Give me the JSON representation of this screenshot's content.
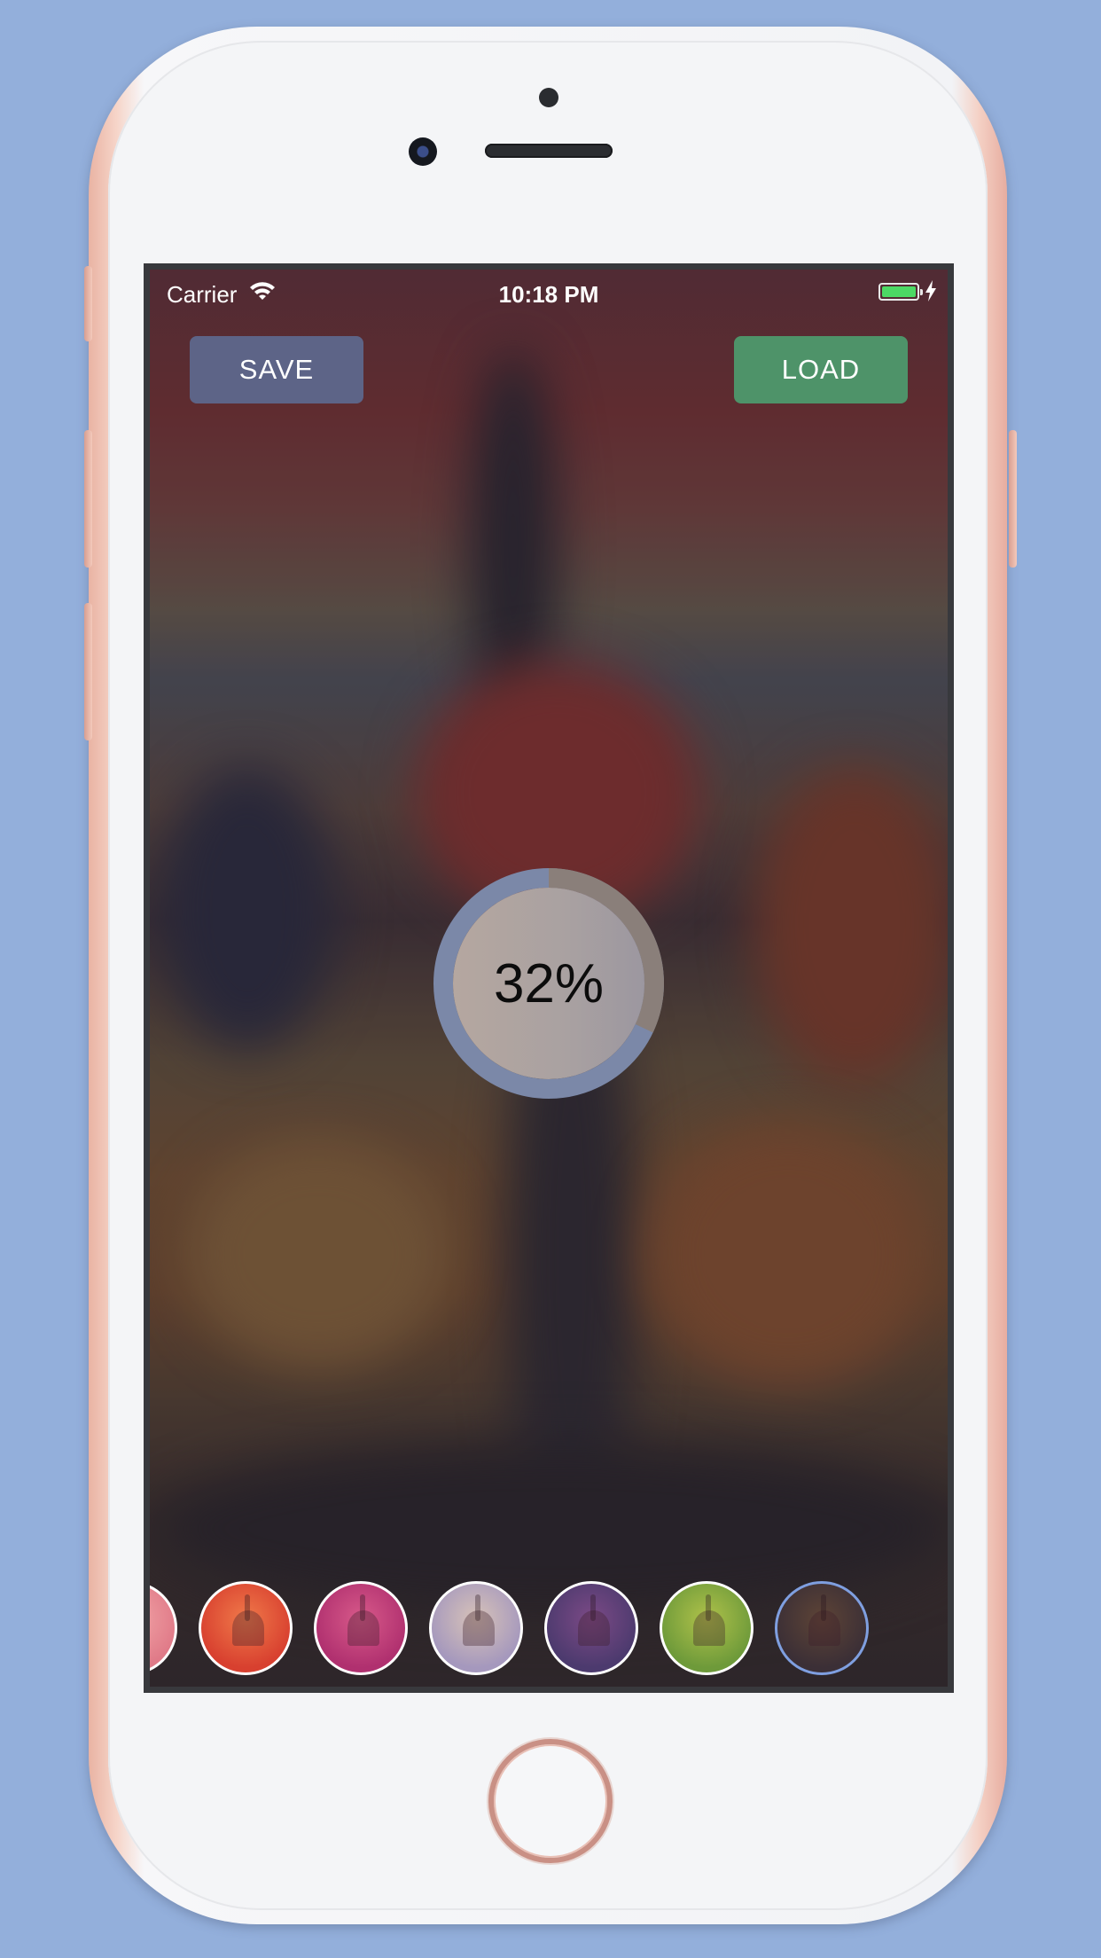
{
  "status_bar": {
    "carrier": "Carrier",
    "time": "10:18 PM",
    "battery_color": "#4cd964"
  },
  "toolbar": {
    "save_label": "SAVE",
    "load_label": "LOAD",
    "save_color": "#5d6487",
    "load_color": "#4e9369"
  },
  "progress": {
    "label": "32%",
    "fraction": 0.32,
    "ring_color": "#7b88a8",
    "fill_color": "#8a7f7a"
  },
  "filters": [
    {
      "name": "filter-pink",
      "base": "#e07a88",
      "accent": "#f2a6a8",
      "selected": false
    },
    {
      "name": "filter-red",
      "base": "#d8402f",
      "accent": "#f07a4a",
      "selected": false
    },
    {
      "name": "filter-magenta",
      "base": "#b0306f",
      "accent": "#d85a8a",
      "selected": false
    },
    {
      "name": "filter-lavender",
      "base": "#a598bd",
      "accent": "#d8c3b8",
      "selected": false
    },
    {
      "name": "filter-purple",
      "base": "#4c3a6e",
      "accent": "#7c4a86",
      "selected": false
    },
    {
      "name": "filter-green",
      "base": "#6e9a3a",
      "accent": "#b0c24a",
      "selected": false
    },
    {
      "name": "filter-dark",
      "base": "#3b2f36",
      "accent": "#5e4436",
      "selected": true
    }
  ]
}
